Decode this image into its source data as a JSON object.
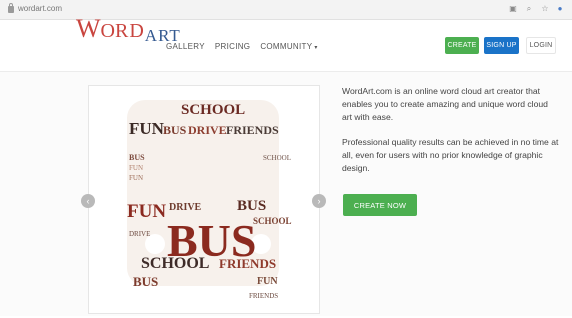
{
  "browser": {
    "url": "wordart.com",
    "icons": [
      "lock-icon",
      "reader-icon",
      "zoom-icon",
      "star-icon",
      "account-icon"
    ]
  },
  "header": {
    "logo": {
      "w": "W",
      "o": "O",
      "rd": "RD",
      "art": "ART"
    },
    "nav": {
      "gallery": "GALLERY",
      "pricing": "PRICING",
      "community": "COMMUNITY"
    },
    "buttons": {
      "create": "CREATE",
      "signup": "SIGN UP",
      "login": "LOGIN"
    },
    "colors": {
      "green": "#4caf50",
      "blue": "#1a73c8",
      "logo_red": "#c9453f",
      "logo_blue": "#355a91"
    }
  },
  "hero": {
    "description_1": "WordArt.com is an online word cloud art creator that enables you to create amazing and unique word cloud art with ease.",
    "description_2": "Professional quality results can be achieved in no time at all, even for users with no prior knowledge of graphic design.",
    "cta": "CREATE NOW",
    "arrows": {
      "left": "‹",
      "right": "›"
    }
  },
  "wordcloud": {
    "big": "BUS",
    "words": {
      "school_top": "SCHOOL",
      "fun_row": "FUN",
      "bus_row": "BUS",
      "drive_row": "DRIVE",
      "friends_row": "FRIENDS",
      "fun_mid": "FUN",
      "fun_small": "FUN",
      "drive_mid": "DRIVE",
      "bus_mid": "BUS",
      "school_right": "SCHOOL",
      "friends_bottom": "FRIENDS",
      "school_bottom": "SCHOOL",
      "bus_left": "BUS",
      "fun_left2": "FUN",
      "drive_left": "DRIVE",
      "bus_bottom": "BUS",
      "fun_bottom": "FUN",
      "school_small": "SCHOOL",
      "friends_small": "FRIENDS"
    }
  }
}
